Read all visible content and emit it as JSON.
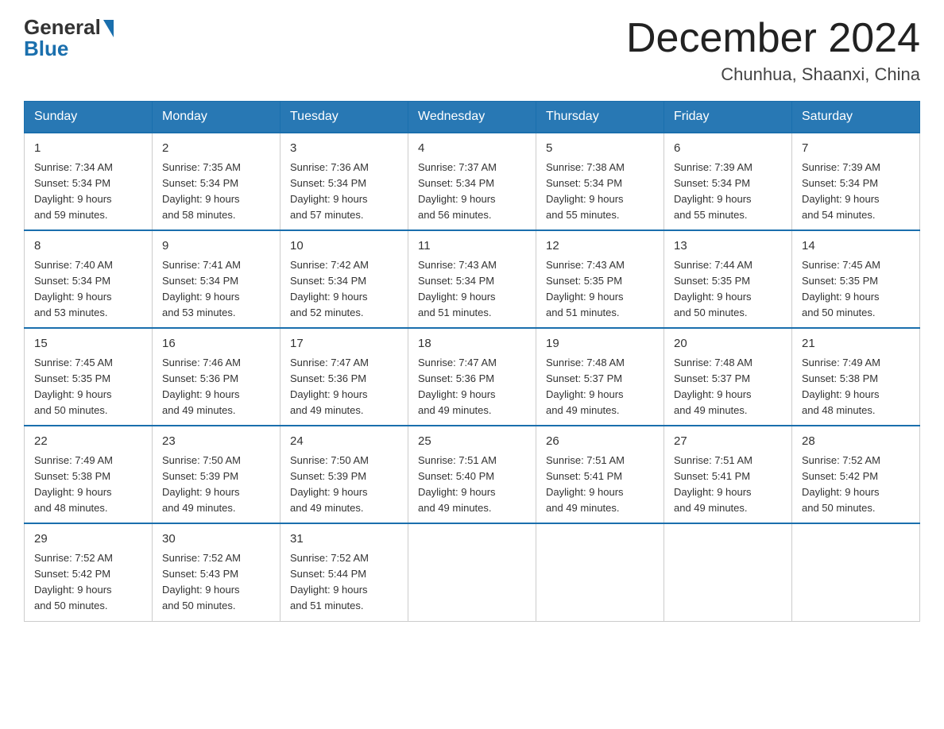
{
  "header": {
    "logo_general": "General",
    "logo_blue": "Blue",
    "month_year": "December 2024",
    "location": "Chunhua, Shaanxi, China"
  },
  "days_of_week": [
    "Sunday",
    "Monday",
    "Tuesday",
    "Wednesday",
    "Thursday",
    "Friday",
    "Saturday"
  ],
  "weeks": [
    [
      {
        "day": "1",
        "sunrise": "7:34 AM",
        "sunset": "5:34 PM",
        "daylight": "9 hours and 59 minutes."
      },
      {
        "day": "2",
        "sunrise": "7:35 AM",
        "sunset": "5:34 PM",
        "daylight": "9 hours and 58 minutes."
      },
      {
        "day": "3",
        "sunrise": "7:36 AM",
        "sunset": "5:34 PM",
        "daylight": "9 hours and 57 minutes."
      },
      {
        "day": "4",
        "sunrise": "7:37 AM",
        "sunset": "5:34 PM",
        "daylight": "9 hours and 56 minutes."
      },
      {
        "day": "5",
        "sunrise": "7:38 AM",
        "sunset": "5:34 PM",
        "daylight": "9 hours and 55 minutes."
      },
      {
        "day": "6",
        "sunrise": "7:39 AM",
        "sunset": "5:34 PM",
        "daylight": "9 hours and 55 minutes."
      },
      {
        "day": "7",
        "sunrise": "7:39 AM",
        "sunset": "5:34 PM",
        "daylight": "9 hours and 54 minutes."
      }
    ],
    [
      {
        "day": "8",
        "sunrise": "7:40 AM",
        "sunset": "5:34 PM",
        "daylight": "9 hours and 53 minutes."
      },
      {
        "day": "9",
        "sunrise": "7:41 AM",
        "sunset": "5:34 PM",
        "daylight": "9 hours and 53 minutes."
      },
      {
        "day": "10",
        "sunrise": "7:42 AM",
        "sunset": "5:34 PM",
        "daylight": "9 hours and 52 minutes."
      },
      {
        "day": "11",
        "sunrise": "7:43 AM",
        "sunset": "5:34 PM",
        "daylight": "9 hours and 51 minutes."
      },
      {
        "day": "12",
        "sunrise": "7:43 AM",
        "sunset": "5:35 PM",
        "daylight": "9 hours and 51 minutes."
      },
      {
        "day": "13",
        "sunrise": "7:44 AM",
        "sunset": "5:35 PM",
        "daylight": "9 hours and 50 minutes."
      },
      {
        "day": "14",
        "sunrise": "7:45 AM",
        "sunset": "5:35 PM",
        "daylight": "9 hours and 50 minutes."
      }
    ],
    [
      {
        "day": "15",
        "sunrise": "7:45 AM",
        "sunset": "5:35 PM",
        "daylight": "9 hours and 50 minutes."
      },
      {
        "day": "16",
        "sunrise": "7:46 AM",
        "sunset": "5:36 PM",
        "daylight": "9 hours and 49 minutes."
      },
      {
        "day": "17",
        "sunrise": "7:47 AM",
        "sunset": "5:36 PM",
        "daylight": "9 hours and 49 minutes."
      },
      {
        "day": "18",
        "sunrise": "7:47 AM",
        "sunset": "5:36 PM",
        "daylight": "9 hours and 49 minutes."
      },
      {
        "day": "19",
        "sunrise": "7:48 AM",
        "sunset": "5:37 PM",
        "daylight": "9 hours and 49 minutes."
      },
      {
        "day": "20",
        "sunrise": "7:48 AM",
        "sunset": "5:37 PM",
        "daylight": "9 hours and 49 minutes."
      },
      {
        "day": "21",
        "sunrise": "7:49 AM",
        "sunset": "5:38 PM",
        "daylight": "9 hours and 48 minutes."
      }
    ],
    [
      {
        "day": "22",
        "sunrise": "7:49 AM",
        "sunset": "5:38 PM",
        "daylight": "9 hours and 48 minutes."
      },
      {
        "day": "23",
        "sunrise": "7:50 AM",
        "sunset": "5:39 PM",
        "daylight": "9 hours and 49 minutes."
      },
      {
        "day": "24",
        "sunrise": "7:50 AM",
        "sunset": "5:39 PM",
        "daylight": "9 hours and 49 minutes."
      },
      {
        "day": "25",
        "sunrise": "7:51 AM",
        "sunset": "5:40 PM",
        "daylight": "9 hours and 49 minutes."
      },
      {
        "day": "26",
        "sunrise": "7:51 AM",
        "sunset": "5:41 PM",
        "daylight": "9 hours and 49 minutes."
      },
      {
        "day": "27",
        "sunrise": "7:51 AM",
        "sunset": "5:41 PM",
        "daylight": "9 hours and 49 minutes."
      },
      {
        "day": "28",
        "sunrise": "7:52 AM",
        "sunset": "5:42 PM",
        "daylight": "9 hours and 50 minutes."
      }
    ],
    [
      {
        "day": "29",
        "sunrise": "7:52 AM",
        "sunset": "5:42 PM",
        "daylight": "9 hours and 50 minutes."
      },
      {
        "day": "30",
        "sunrise": "7:52 AM",
        "sunset": "5:43 PM",
        "daylight": "9 hours and 50 minutes."
      },
      {
        "day": "31",
        "sunrise": "7:52 AM",
        "sunset": "5:44 PM",
        "daylight": "9 hours and 51 minutes."
      },
      null,
      null,
      null,
      null
    ]
  ],
  "labels": {
    "sunrise": "Sunrise:",
    "sunset": "Sunset:",
    "daylight": "Daylight:"
  }
}
